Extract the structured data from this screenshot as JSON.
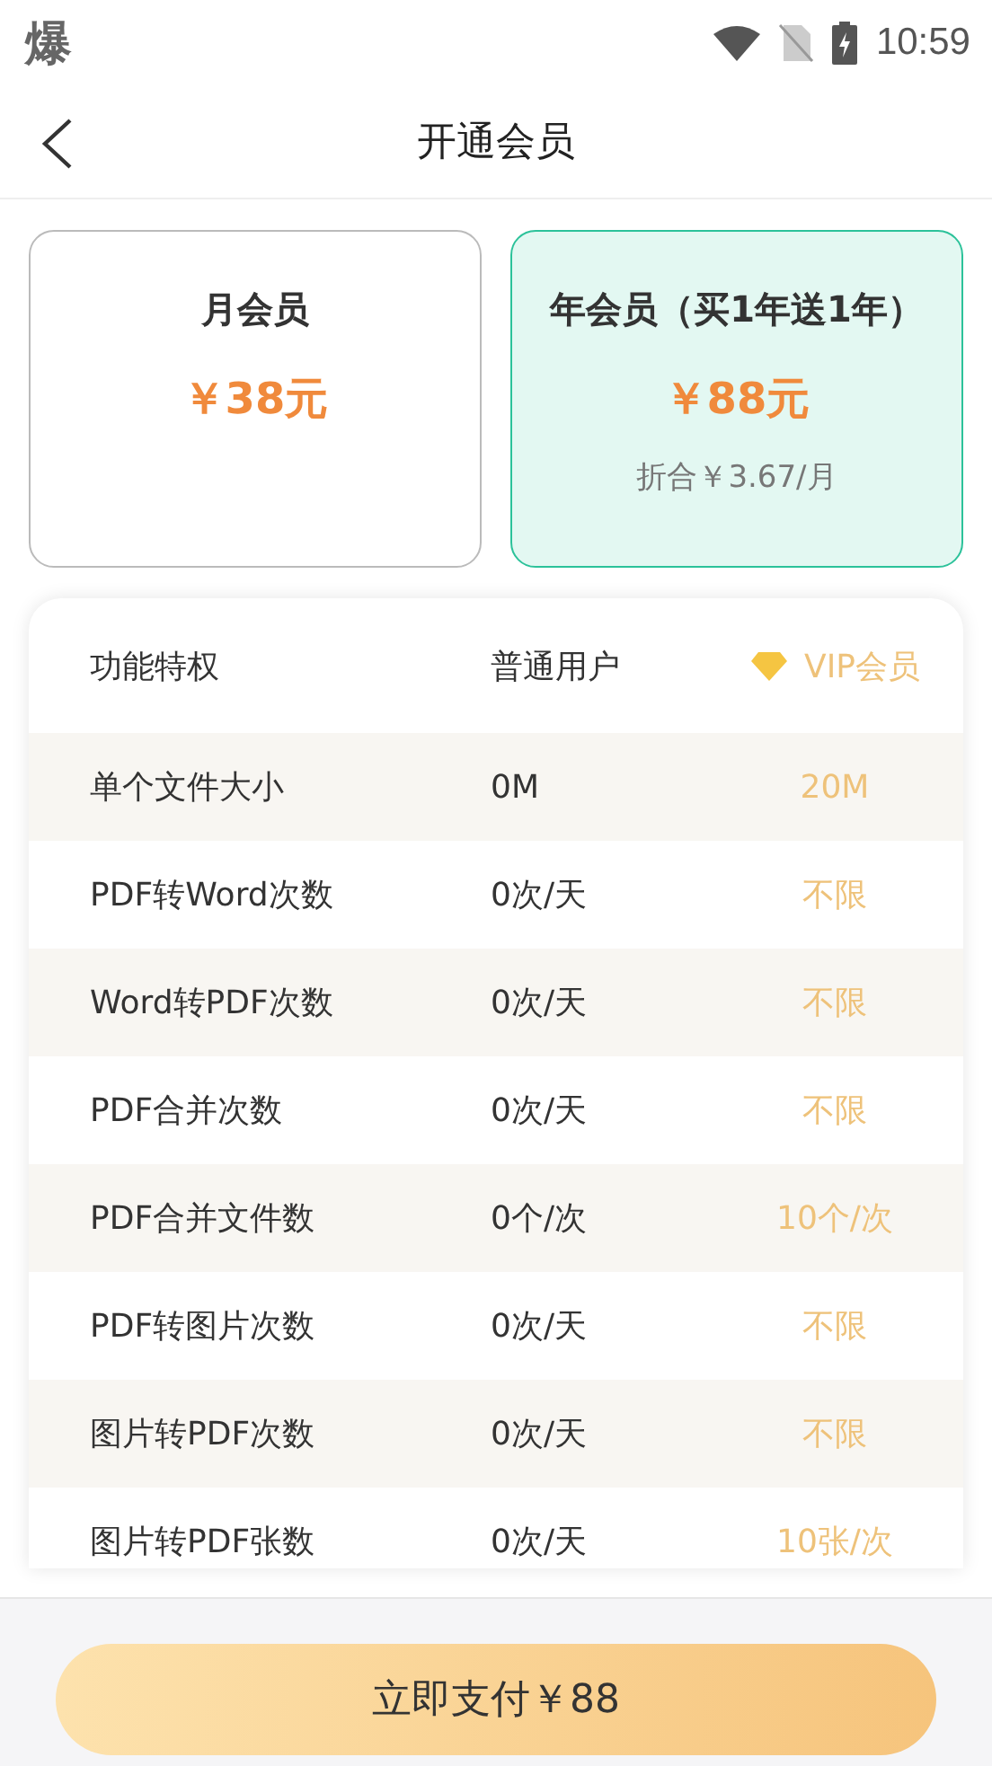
{
  "status_bar": {
    "app_icon": "爆",
    "time": "10:59"
  },
  "header": {
    "title": "开通会员"
  },
  "plans": [
    {
      "name": "月会员",
      "price": "￥38元",
      "selected": false
    },
    {
      "name": "年会员（买1年送1年）",
      "price": "￥88元",
      "note": "折合￥3.67/月",
      "selected": true
    }
  ],
  "table": {
    "columns": [
      "功能特权",
      "普通用户",
      "VIP会员"
    ],
    "rows": [
      [
        "单个文件大小",
        "0M",
        "20M"
      ],
      [
        "PDF转Word次数",
        "0次/天",
        "不限"
      ],
      [
        "Word转PDF次数",
        "0次/天",
        "不限"
      ],
      [
        "PDF合并次数",
        "0次/天",
        "不限"
      ],
      [
        "PDF合并文件数",
        "0个/次",
        "10个/次"
      ],
      [
        "PDF转图片次数",
        "0次/天",
        "不限"
      ],
      [
        "图片转PDF次数",
        "0次/天",
        "不限"
      ],
      [
        "图片转PDF张数",
        "0次/天",
        "10张/次"
      ]
    ]
  },
  "pay_button": "立即支付￥88"
}
